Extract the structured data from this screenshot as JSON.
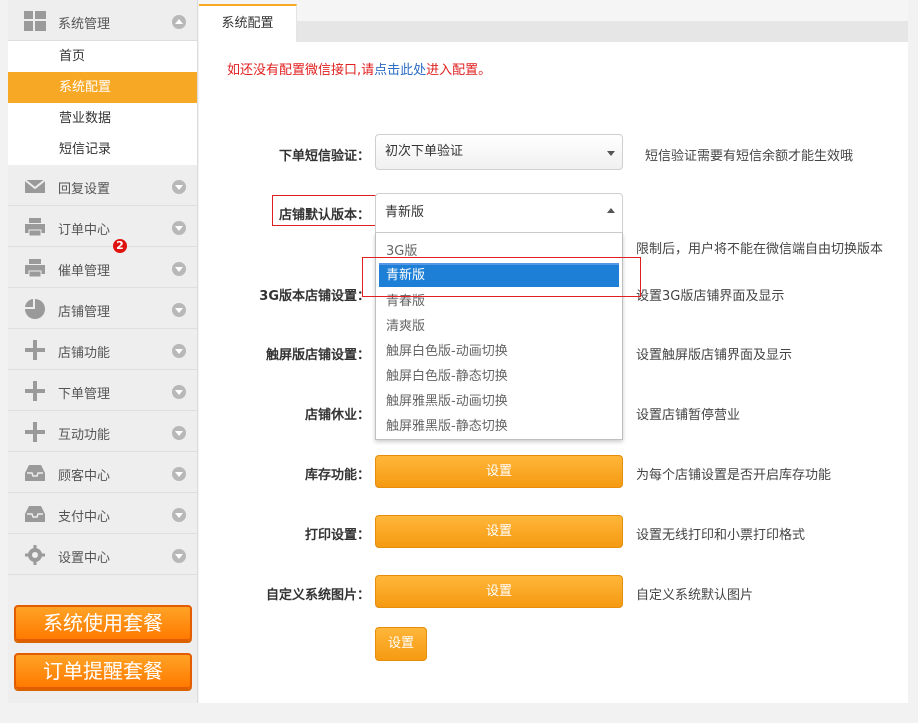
{
  "sidebar": {
    "groups": [
      {
        "label": "系统管理",
        "icon": "grid-icon",
        "expanded": true
      },
      {
        "label": "回复设置",
        "icon": "envelope-icon"
      },
      {
        "label": "订单中心",
        "icon": "printer-icon",
        "badge": "2"
      },
      {
        "label": "催单管理",
        "icon": "printer-icon"
      },
      {
        "label": "店铺管理",
        "icon": "pie-chart-icon"
      },
      {
        "label": "店铺功能",
        "icon": "plus-icon"
      },
      {
        "label": "下单管理",
        "icon": "plus-icon"
      },
      {
        "label": "互动功能",
        "icon": "plus-icon"
      },
      {
        "label": "顾客中心",
        "icon": "inbox-icon"
      },
      {
        "label": "支付中心",
        "icon": "inbox-icon"
      },
      {
        "label": "设置中心",
        "icon": "gear-icon"
      }
    ],
    "sub_items": [
      "首页",
      "系统配置",
      "营业数据",
      "短信记录"
    ],
    "active_sub_item": "系统配置",
    "package_buttons": [
      "系统使用套餐",
      "订单提醒套餐"
    ]
  },
  "tab": {
    "label": "系统配置"
  },
  "notice": {
    "prefix": "如还没有配置微信接口,请",
    "link": "点击此处",
    "suffix": "进入配置。"
  },
  "form": {
    "sms": {
      "label": "下单短信验证：",
      "value": "初次下单验证",
      "desc": "短信验证需要有短信余额才能生效哦"
    },
    "version": {
      "label": "店铺默认版本：",
      "value": "青新版",
      "desc": "限制后，用户将不能在微信端自由切换版本",
      "options": [
        "3G版",
        "青新版",
        "青春版",
        "清爽版",
        "触屏白色版-动画切换",
        "触屏白色版-静态切换",
        "触屏雅黑版-动画切换",
        "触屏雅黑版-静态切换"
      ],
      "highlighted_option": "青新版"
    },
    "g3": {
      "label": "3G版本店铺设置：",
      "desc": "设置3G版店铺界面及显示"
    },
    "touch": {
      "label": "触屏版店铺设置：",
      "desc": "设置触屏版店铺界面及显示"
    },
    "rest": {
      "label": "店铺休业：",
      "desc": "设置店铺暂停营业"
    },
    "stock": {
      "label": "库存功能：",
      "button": "设置",
      "desc": "为每个店铺设置是否开启库存功能"
    },
    "print": {
      "label": "打印设置：",
      "button": "设置",
      "desc": "设置无线打印和小票打印格式"
    },
    "images": {
      "label": "自定义系统图片：",
      "button": "设置",
      "desc": "自定义系统默认图片"
    },
    "submit": "设置"
  },
  "colors": {
    "accent": "#f7a824",
    "notice": "#e02020",
    "link": "#2a6cc4",
    "option_selected": "#1e7fd6",
    "badge": "#e0120f"
  }
}
